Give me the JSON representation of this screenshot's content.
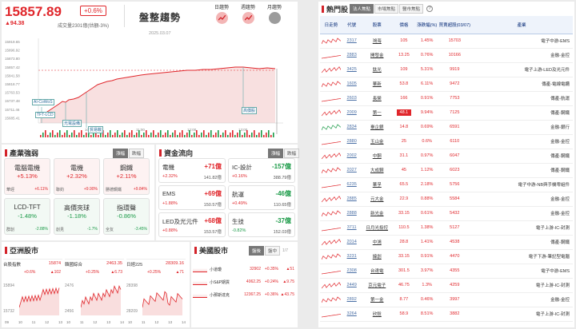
{
  "index": {
    "value": "15857.89",
    "change_pct": "+0.6%",
    "change_pts": "▲94.38",
    "volume": "成交量2301億(估額-3%)",
    "trend_label": "盤整趨勢",
    "date": "2025.03.07",
    "tabs": [
      "日趨勢",
      "週趨勢",
      "月趨勢"
    ]
  },
  "intraday": {
    "yticks": [
      "15919.65",
      "15896.92",
      "15873.80",
      "15857.42",
      "15841.58",
      "15818.77",
      "15763.53",
      "15737.48",
      "15711.46",
      "15685.41"
    ],
    "xticks": [
      "10:00",
      "11:00",
      "12:00",
      "13:00"
    ],
    "markers": [
      "AI-CoWoS",
      "TFT-LCD",
      "光電設備",
      "貿易戰",
      "高價股"
    ]
  },
  "industry": {
    "title": "產業強弱",
    "btns": [
      "漲幅",
      "跌幅"
    ],
    "cards": [
      {
        "name": "電腦電機",
        "pct": "+5.13%",
        "sub": "華經",
        "subpct": "+6.11%"
      },
      {
        "name": "電機",
        "pct": "+2.32%",
        "sub": "聯鈞",
        "subpct": "+9.90%"
      },
      {
        "name": "鋼鐵",
        "pct": "+2.11%",
        "sub": "勝德鋼鐵",
        "subpct": "+9.84%"
      },
      {
        "name": "LCD-TFT",
        "pct": "-1.48%",
        "sub": "群創",
        "subpct": "-2.88%"
      },
      {
        "name": "高價夾球",
        "pct": "-1.18%",
        "sub": "創見",
        "subpct": "-1.7%"
      },
      {
        "name": "指環聲",
        "pct": "-0.86%",
        "sub": "全友",
        "subpct": "-3.45%"
      }
    ]
  },
  "capital": {
    "title": "資金流向",
    "btns": [
      "漲幅",
      "跌幅"
    ],
    "cards": [
      {
        "name": "電機",
        "amt": "+71億",
        "pct": "+2.32%",
        "total": "141.82億"
      },
      {
        "name": "IC-設計",
        "amt": "-157億",
        "pct": "+0.16%",
        "total": "388.79億"
      },
      {
        "name": "EMS",
        "amt": "+69億",
        "pct": "+1.88%",
        "total": "150.57億"
      },
      {
        "name": "航運",
        "amt": "-46億",
        "pct": "+0.49%",
        "total": "110.65億"
      },
      {
        "name": "LED及光元件",
        "amt": "+68億",
        "pct": "+0.88%",
        "total": "153.57億"
      },
      {
        "name": "生技",
        "amt": "-37億",
        "pct": "-0.82%",
        "total": "152.03億"
      }
    ]
  },
  "asia": {
    "title": "亞洲股市",
    "charts": [
      {
        "name": "台股指數",
        "value": "15874",
        "chg": "+0.6%",
        "pts": "▲102",
        "hi": "15894",
        "lo": "15732",
        "ticks": [
          "09",
          "10",
          "11",
          "12",
          "13"
        ]
      },
      {
        "name": "韓國綜合",
        "value": "2463.35",
        "chg": "+0.25%",
        "pts": "▲6.73",
        "hi": "2476",
        "lo": "2456",
        "ticks": [
          "10",
          "11",
          "12",
          "13",
          "14"
        ]
      },
      {
        "name": "日經225",
        "value": "28309.16",
        "chg": "+0.25%",
        "pts": "▲71",
        "hi": "28398",
        "lo": "28209",
        "ticks": [
          "10",
          "11",
          "12",
          "13",
          "14"
        ]
      }
    ]
  },
  "us": {
    "title": "美國股市",
    "btns": [
      "盤後",
      "盤中"
    ],
    "page": "1/7",
    "rows": [
      {
        "name": "小道瓊",
        "value": "32902",
        "pct": "+0.35%",
        "pts": "▲51"
      },
      {
        "name": "小S&P期貨",
        "value": "4062.25",
        "pct": "+0.24%",
        "pts": "▲9.75"
      },
      {
        "name": "小那斯達克",
        "value": "12367.25",
        "pct": "+0.36%",
        "pts": "▲43.75"
      }
    ]
  },
  "hot": {
    "title": "熱門股",
    "tabs": [
      "法人焦點",
      "市場焦點",
      "醫市焦點"
    ],
    "headers": [
      "日走勢",
      "代號",
      "股票",
      "價格",
      "漲跌幅(%)",
      "買賣超股(03/07)",
      "產業"
    ],
    "rows": [
      [
        "2317",
        "鴻海",
        "105",
        "1.45%",
        "15703",
        "電子中游-EMS"
      ],
      [
        "2883",
        "開發金",
        "13.25",
        "0.76%",
        "10166",
        "金融-金控"
      ],
      [
        "3425",
        "鈦光",
        "109",
        "5.31%",
        "9919",
        "電子上游-LED及光元件"
      ],
      [
        "1605",
        "華新",
        "53.8",
        "6.11%",
        "9472",
        "傳產-電線電纜"
      ],
      [
        "2603",
        "長榮",
        "166",
        "0.91%",
        "7753",
        "傳產-航運"
      ],
      [
        "2009",
        "第一",
        "48.1",
        "9.94%",
        "7125",
        "傳產-鋼鐵"
      ],
      [
        "2834",
        "臺企銀",
        "14.8",
        "0.69%",
        "6591",
        "金融-銀行"
      ],
      [
        "2880",
        "玉山金",
        "25",
        "0.6%",
        "6110",
        "金融-金控"
      ],
      [
        "2002",
        "中鋼",
        "31.1",
        "0.97%",
        "6047",
        "傳產-鋼鐵"
      ],
      [
        "2027",
        "大成鋼",
        "45",
        "1.12%",
        "6023",
        "傳產-鋼鐵"
      ],
      [
        "6235",
        "華孚",
        "65.5",
        "2.18%",
        "5756",
        "電子中游-NB與手機零組件"
      ],
      [
        "2885",
        "元大金",
        "22.9",
        "0.88%",
        "5584",
        "金融-金控"
      ],
      [
        "2888",
        "新光金",
        "33.15",
        "0.61%",
        "5432",
        "金融-金控"
      ],
      [
        "3711",
        "日月光投控",
        "110.5",
        "1.38%",
        "5127",
        "電子上游-IC-封測"
      ],
      [
        "2014",
        "中鴻",
        "28.8",
        "1.41%",
        "4538",
        "傳產-鋼鐵"
      ],
      [
        "3231",
        "緯創",
        "33.15",
        "0.91%",
        "4470",
        "電子下游-筆記型電腦"
      ],
      [
        "2308",
        "台達電",
        "301.5",
        "3.97%",
        "4355",
        "電子中游-EMS"
      ],
      [
        "2449",
        "京元電子",
        "46.75",
        "1.3%",
        "4259",
        "電子上游-IC-封測"
      ],
      [
        "2892",
        "第一金",
        "8.77",
        "0.46%",
        "3997",
        "金融-金控"
      ],
      [
        "3264",
        "欣銓",
        "58.9",
        "8.51%",
        "3882",
        "電子上游-IC-封測"
      ]
    ]
  },
  "colors": {
    "up": "#e0262b",
    "down": "#1a9a47",
    "accent": "#d3232a",
    "hot_header": "#eef3fb"
  }
}
